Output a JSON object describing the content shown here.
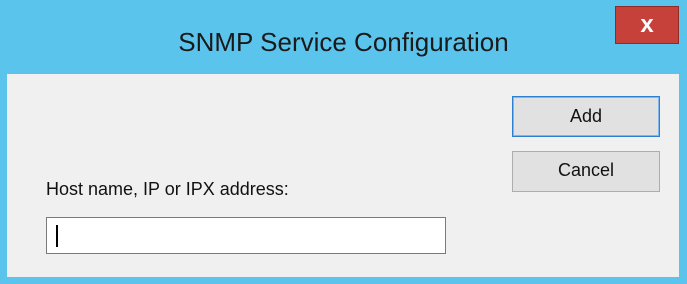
{
  "window": {
    "title": "SNMP Service Configuration",
    "close_glyph": "x"
  },
  "buttons": {
    "add_label": "Add",
    "cancel_label": "Cancel"
  },
  "host_field": {
    "label": "Host name, IP or IPX address:",
    "value": ""
  },
  "colors": {
    "titlebar": "#5bc4ec",
    "close_button": "#c6413a",
    "client_area": "#f0f0f0",
    "default_button_border": "#2c7fd1"
  },
  "icons": {
    "close": "close-icon"
  }
}
